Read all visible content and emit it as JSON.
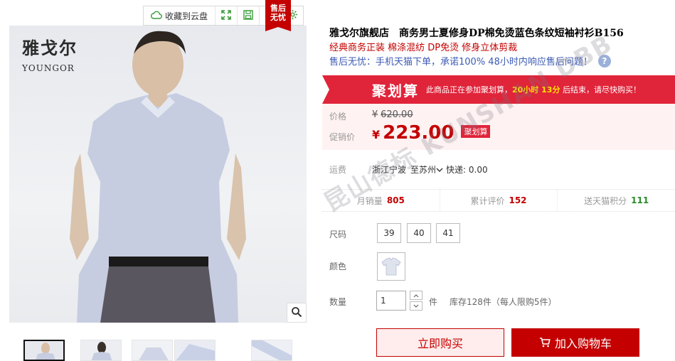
{
  "toolbar": {
    "cloud_label": "收藏到云盘",
    "icons": [
      "cloud-icon",
      "expand-icon",
      "save-icon",
      "share-icon",
      "settings-icon"
    ]
  },
  "brand": {
    "cn": "雅戈尔",
    "en": "YOUNGOR"
  },
  "image_badge": {
    "line1": "售后",
    "line2": "无忧"
  },
  "product": {
    "title": "雅戈尔旗舰店　商务男士夏修身DP棉免烫蓝色条纹短袖衬衫B156",
    "subtitle": "经典商务正装  棉涤混纺  DP免烫  修身立体剪裁",
    "promise": "售后无忧：手机天猫下单，承诺100% 48小时内响应售后问题！",
    "help_glyph": "?"
  },
  "ju_banner": {
    "brand": "聚划算",
    "text_pre": "此商品正在参加聚划算，",
    "countdown": "20小时 13分",
    "text_post": " 后结束，请尽快购买！"
  },
  "price": {
    "orig_label": "价格",
    "currency": "¥",
    "original": "620.00",
    "sale_label": "促销价",
    "sale": "223.00",
    "sale_tag": "聚划算"
  },
  "shipping": {
    "label": "运费",
    "from": "浙江宁波",
    "to": "至苏州",
    "express": "快递: 0.00"
  },
  "stats": [
    {
      "label": "月销量",
      "value": "805",
      "color": "#c40000"
    },
    {
      "label": "累计评价",
      "value": "152",
      "color": "#c40000"
    },
    {
      "label": "送天猫积分",
      "value": "111",
      "color": "#2b8a2b"
    }
  ],
  "options": {
    "size_label": "尺码",
    "sizes": [
      "39",
      "40",
      "41"
    ],
    "color_label": "颜色",
    "qty_label": "数量",
    "qty_value": "1",
    "qty_unit": "件",
    "stock": "库存128件（每人限购5件）"
  },
  "buttons": {
    "buy_now": "立即购买",
    "add_cart": "加入购物车"
  },
  "watermark": "昆山德标 KUNSHAN DBB",
  "colors": {
    "tmall_red": "#c40000",
    "ju_red": "#e0243a",
    "link_blue": "#3c5bb5"
  }
}
